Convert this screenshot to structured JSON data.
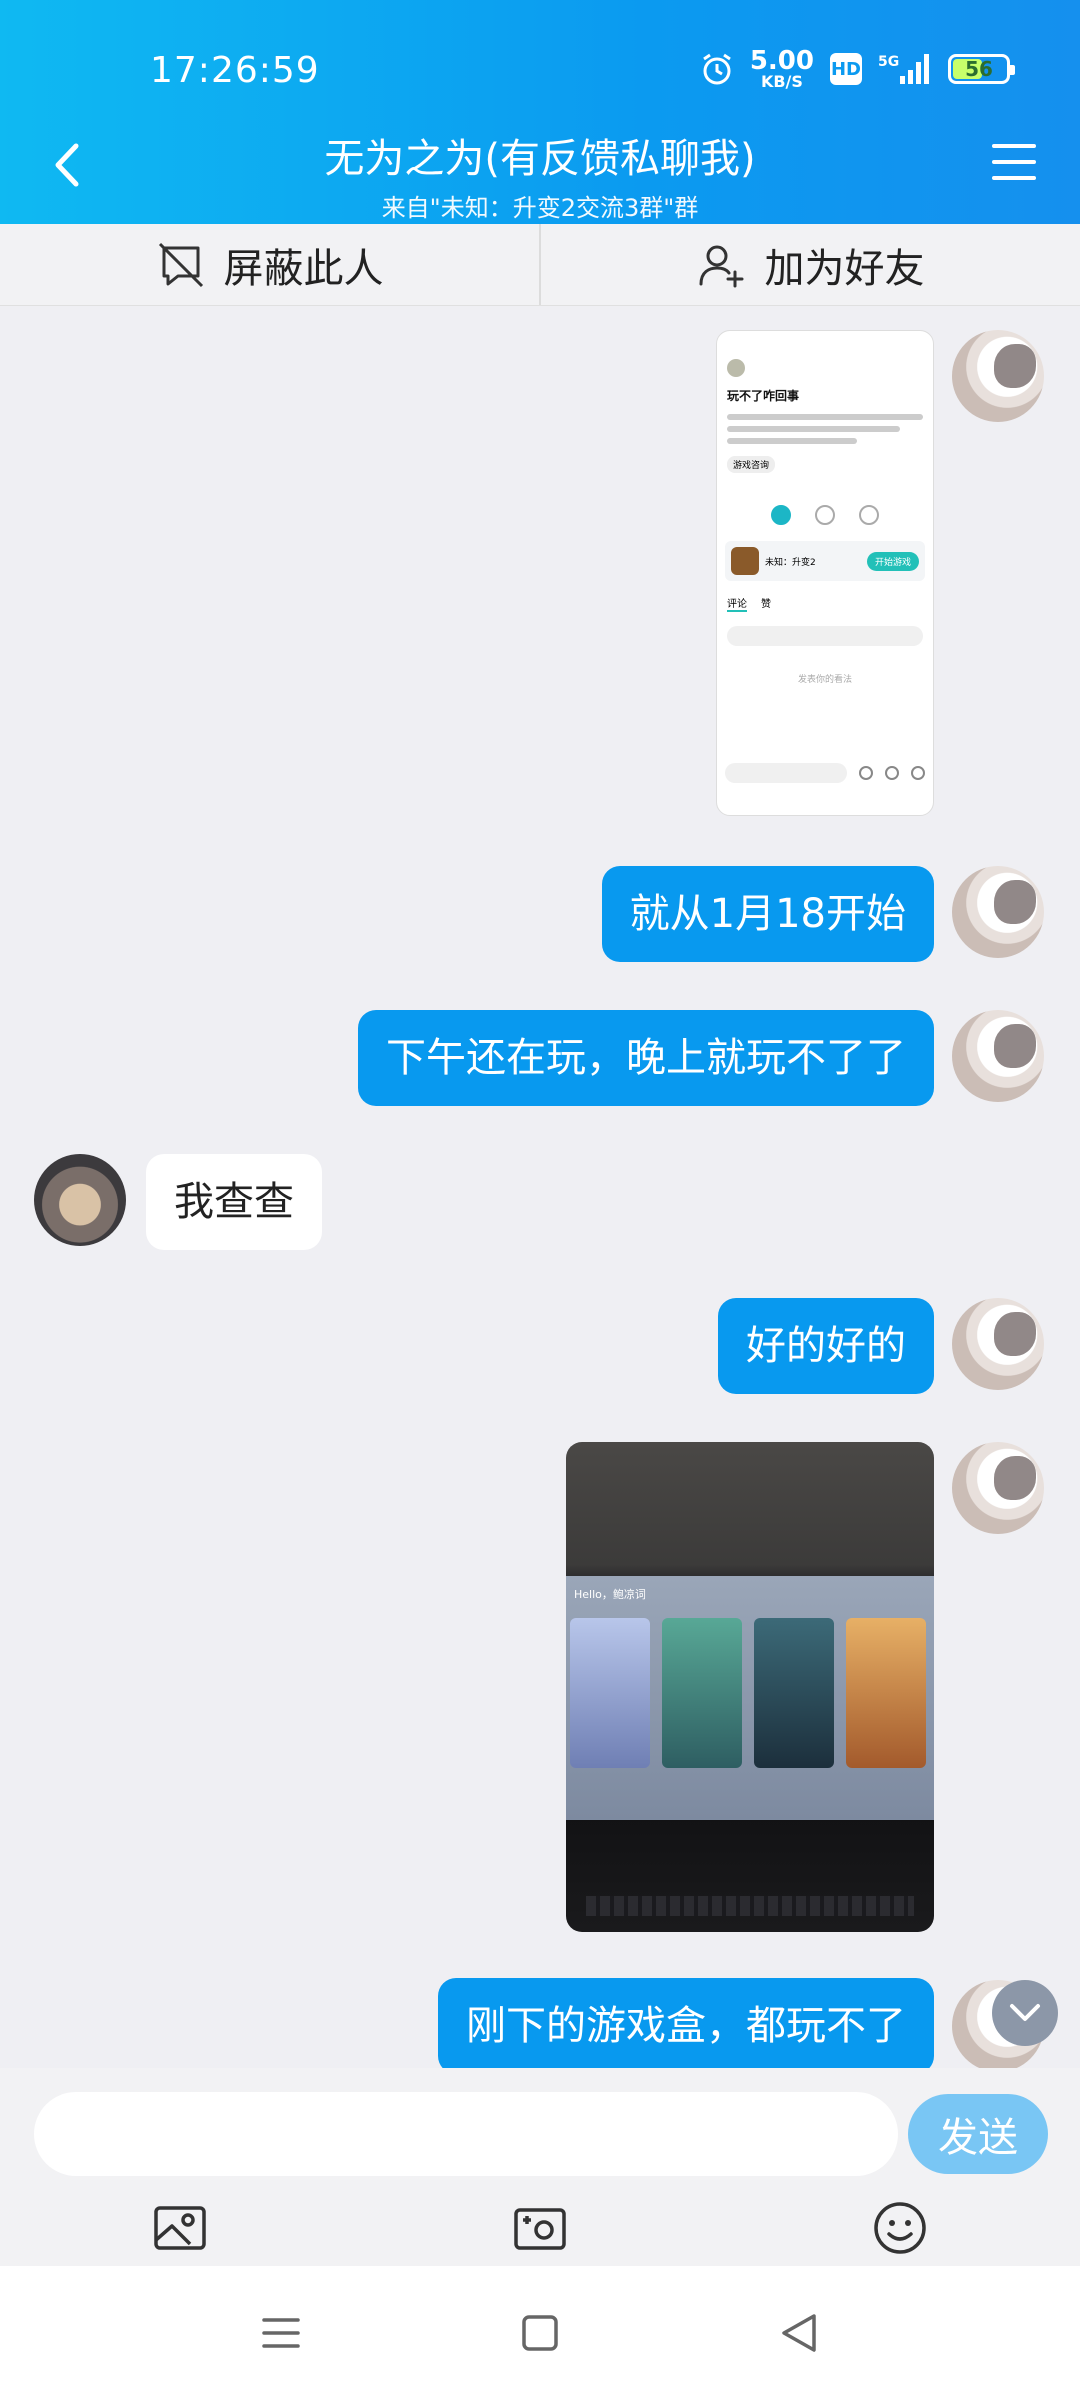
{
  "status_bar": {
    "time": "17:26:59",
    "net_speed_value": "5.00",
    "net_speed_unit": "KB/S",
    "hd_label": "HD",
    "signal_label": "5G",
    "battery_level": "56"
  },
  "header": {
    "title": "无为之为(有反馈私聊我)",
    "subtitle": "来自\"未知：升变2交流3群\"群",
    "back_icon": "chevron-left-icon",
    "menu_icon": "hamburger-menu-icon"
  },
  "actions": {
    "block_label": "屏蔽此人",
    "add_friend_label": "加为好友"
  },
  "messages": [
    {
      "from": "me",
      "type": "image",
      "desc": "app-screenshot"
    },
    {
      "from": "me",
      "type": "text",
      "text": "就从1月18开始"
    },
    {
      "from": "me",
      "type": "text",
      "text": "下午还在玩，晚上就玩不了了"
    },
    {
      "from": "other",
      "type": "text",
      "text": "我查查"
    },
    {
      "from": "me",
      "type": "text",
      "text": "好的好的"
    },
    {
      "from": "me",
      "type": "image",
      "desc": "monitor-photo"
    },
    {
      "from": "me",
      "type": "text",
      "text": "刚下的游戏盒，都玩不了"
    }
  ],
  "shot1": {
    "title": "玩不了咋回事",
    "tag": "游戏咨询",
    "game_name": "未知：升变2",
    "game_button": "开始游戏",
    "tab_comment": "评论",
    "tab_like": "赞",
    "empty_text": "发表你的看法"
  },
  "shot2": {
    "hello": "Hello，鲍凉词"
  },
  "composer": {
    "input_value": "",
    "send_label": "发送",
    "tools": [
      "image-icon",
      "camera-icon",
      "emoji-icon"
    ]
  },
  "colors": {
    "header_blue": "#0b9af0",
    "bubble_blue": "#0899ef",
    "send_blue": "#79c6f4"
  }
}
